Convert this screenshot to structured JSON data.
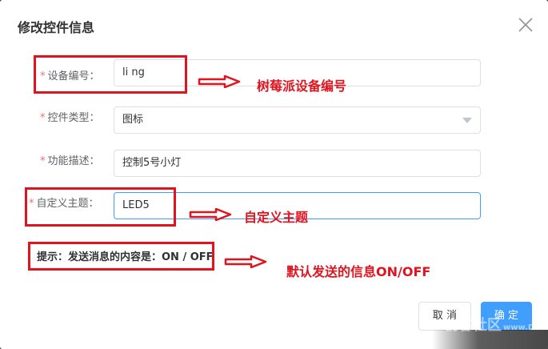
{
  "dialog": {
    "title": "修改控件信息",
    "close_icon": "close-icon"
  },
  "form": {
    "device_id": {
      "required_mark": "*",
      "label": "设备编号：",
      "value": "li        ng"
    },
    "control_type": {
      "required_mark": "*",
      "label": "控件类型：",
      "value": "图标",
      "icon": "chevron-down-icon"
    },
    "description": {
      "required_mark": "*",
      "label": "功能描述：",
      "value": "控制5号小灯"
    },
    "custom_topic": {
      "required_mark": "*",
      "label": "自定义主题：",
      "value": "LED5"
    }
  },
  "hint": "提示：发送消息的内容是：ON / OFF",
  "annotations": {
    "device_id": "树莓派设备编号",
    "custom_topic": "自定义主题",
    "hint": "默认发送的信息ON/OFF",
    "color": "#e0141e"
  },
  "buttons": {
    "cancel": "取 消",
    "confirm": "确 定"
  },
  "watermark": {
    "text": "创客社区",
    "site": "www.DFRobot.com.cn"
  },
  "colors": {
    "primary": "#409eff",
    "required": "#f56c6c",
    "annotation": "#e0141e"
  }
}
